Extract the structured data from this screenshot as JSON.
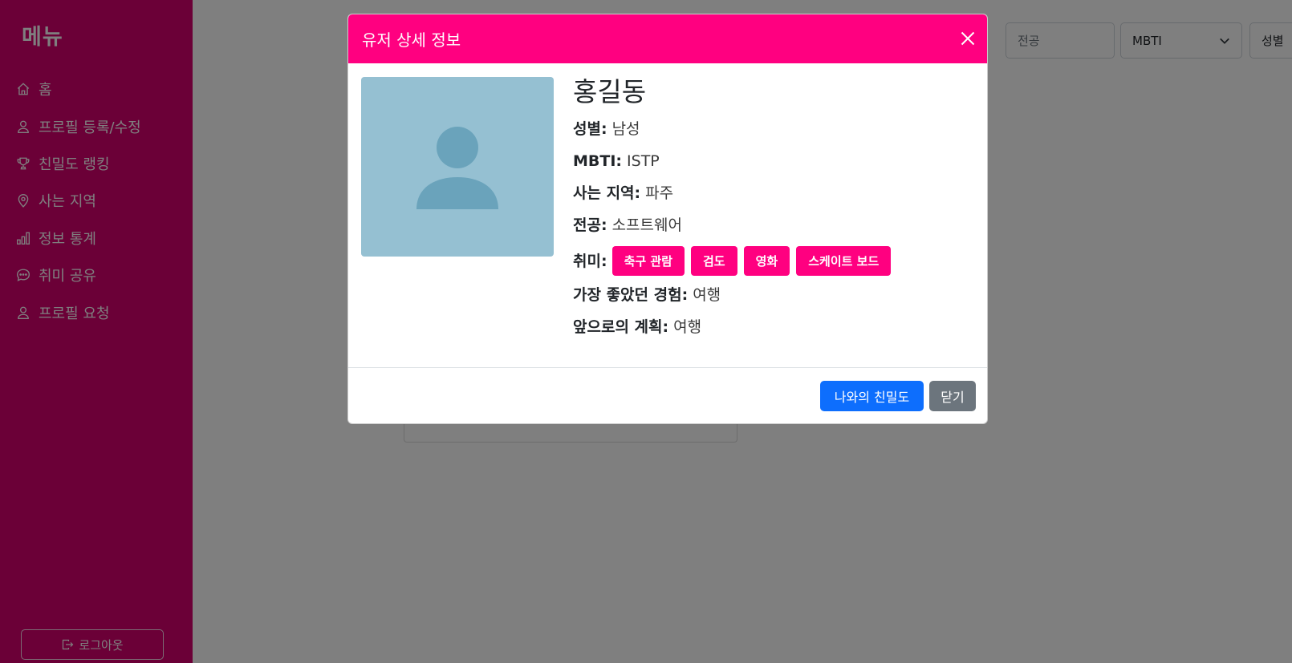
{
  "sidebar": {
    "title": "메뉴",
    "items": [
      {
        "label": "홈",
        "icon": "home-icon"
      },
      {
        "label": "프로필 등록/수정",
        "icon": "person-icon"
      },
      {
        "label": "친밀도 랭킹",
        "icon": "trophy-icon"
      },
      {
        "label": "사는 지역",
        "icon": "location-pin-icon"
      },
      {
        "label": "정보 통계",
        "icon": "bar-chart-icon"
      },
      {
        "label": "취미 공유",
        "icon": "chat-icon"
      },
      {
        "label": "프로필 요청",
        "icon": "person-icon"
      }
    ],
    "logout_label": "로그아웃"
  },
  "filters": {
    "major_placeholder": "전공",
    "mbti_value": "MBTI",
    "gender_value": "성별"
  },
  "modal": {
    "title": "유저 상세 정보",
    "user": {
      "name": "홍길동",
      "gender_label": "성별:",
      "gender": "남성",
      "mbti_label": "MBTI:",
      "mbti": "ISTP",
      "region_label": "사는 지역:",
      "region": "파주",
      "major_label": "전공:",
      "major": "소프트웨어",
      "hobby_label": "취미:",
      "hobbies": [
        "축구 관람",
        "검도",
        "영화",
        "스케이트 보드"
      ],
      "best_experience_label": "가장 좋았던 경험:",
      "best_experience": "여행",
      "future_plan_label": "앞으로의 계획:",
      "future_plan": "여행"
    },
    "intimacy_button": "나와의 친밀도",
    "close_button": "닫기"
  },
  "colors": {
    "sidebar": "#d6006f",
    "modal_header": "#ff0080",
    "primary": "#0d6efd",
    "secondary": "#6c757d",
    "avatar_bg": "#95c0d2",
    "avatar_figure": "#6aa3bb"
  }
}
